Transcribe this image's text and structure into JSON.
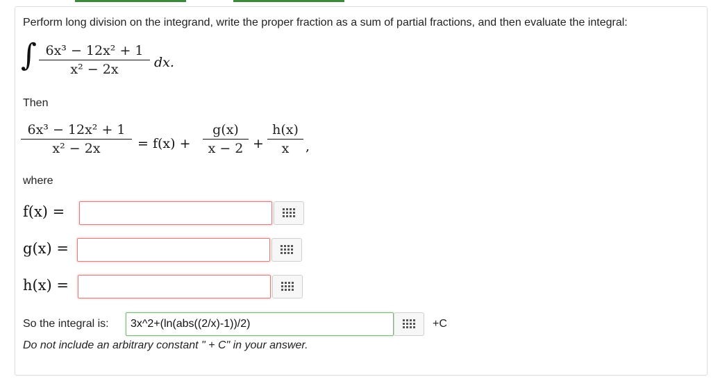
{
  "prompt": "Perform long division on the integrand, write the proper fraction as a sum of partial fractions, and then evaluate the integral:",
  "integral": {
    "sign": "∫",
    "numerator": "6x³ − 12x² + 1",
    "denominator": "x² − 2x",
    "differential": "dx."
  },
  "then_label": "Then",
  "equation": {
    "lhs_num": "6x³ − 12x² + 1",
    "lhs_den": "x² − 2x",
    "equals": "= f(x) +",
    "g_num": "g(x)",
    "g_den": "x − 2",
    "plus": "+",
    "h_num": "h(x)",
    "h_den": "x",
    "comma": ","
  },
  "where_label": "where",
  "fields": [
    {
      "label": "f(x) =",
      "value": ""
    },
    {
      "label": "g(x) =",
      "value": ""
    },
    {
      "label": "h(x) =",
      "value": ""
    }
  ],
  "answer": {
    "label": "So the integral is:",
    "value": "3x^2+(ln(abs((2/x)-1))/2)",
    "suffix": "+C"
  },
  "note": "Do not include an arbitrary constant \" + C\" in your answer.",
  "colors": {
    "accent_green": "#3c8a3c",
    "error_border": "#d98080",
    "ok_border": "#7cb87c"
  },
  "icons": {
    "keyboard": "keypad-icon"
  }
}
